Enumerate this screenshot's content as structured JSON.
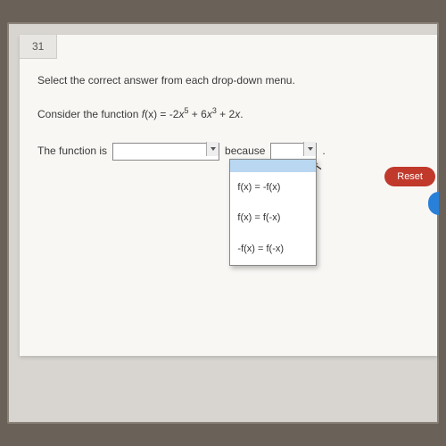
{
  "question_number": "31",
  "instructions": "Select the correct answer from each drop-down menu.",
  "consider_prefix": "Consider the function ",
  "func_label": "f",
  "func_arg": "(x) = -2",
  "var": "x",
  "exp1": "5",
  "plus1": " + 6",
  "exp2": "3",
  "plus2": " + 2",
  "period": ".",
  "answer_prefix": "The function is",
  "because": "because",
  "dropdown2_options": [
    "",
    "f(x) = -f(x)",
    "f(x) = f(-x)",
    "-f(x) = f(-x)"
  ],
  "reset_label": "Reset"
}
